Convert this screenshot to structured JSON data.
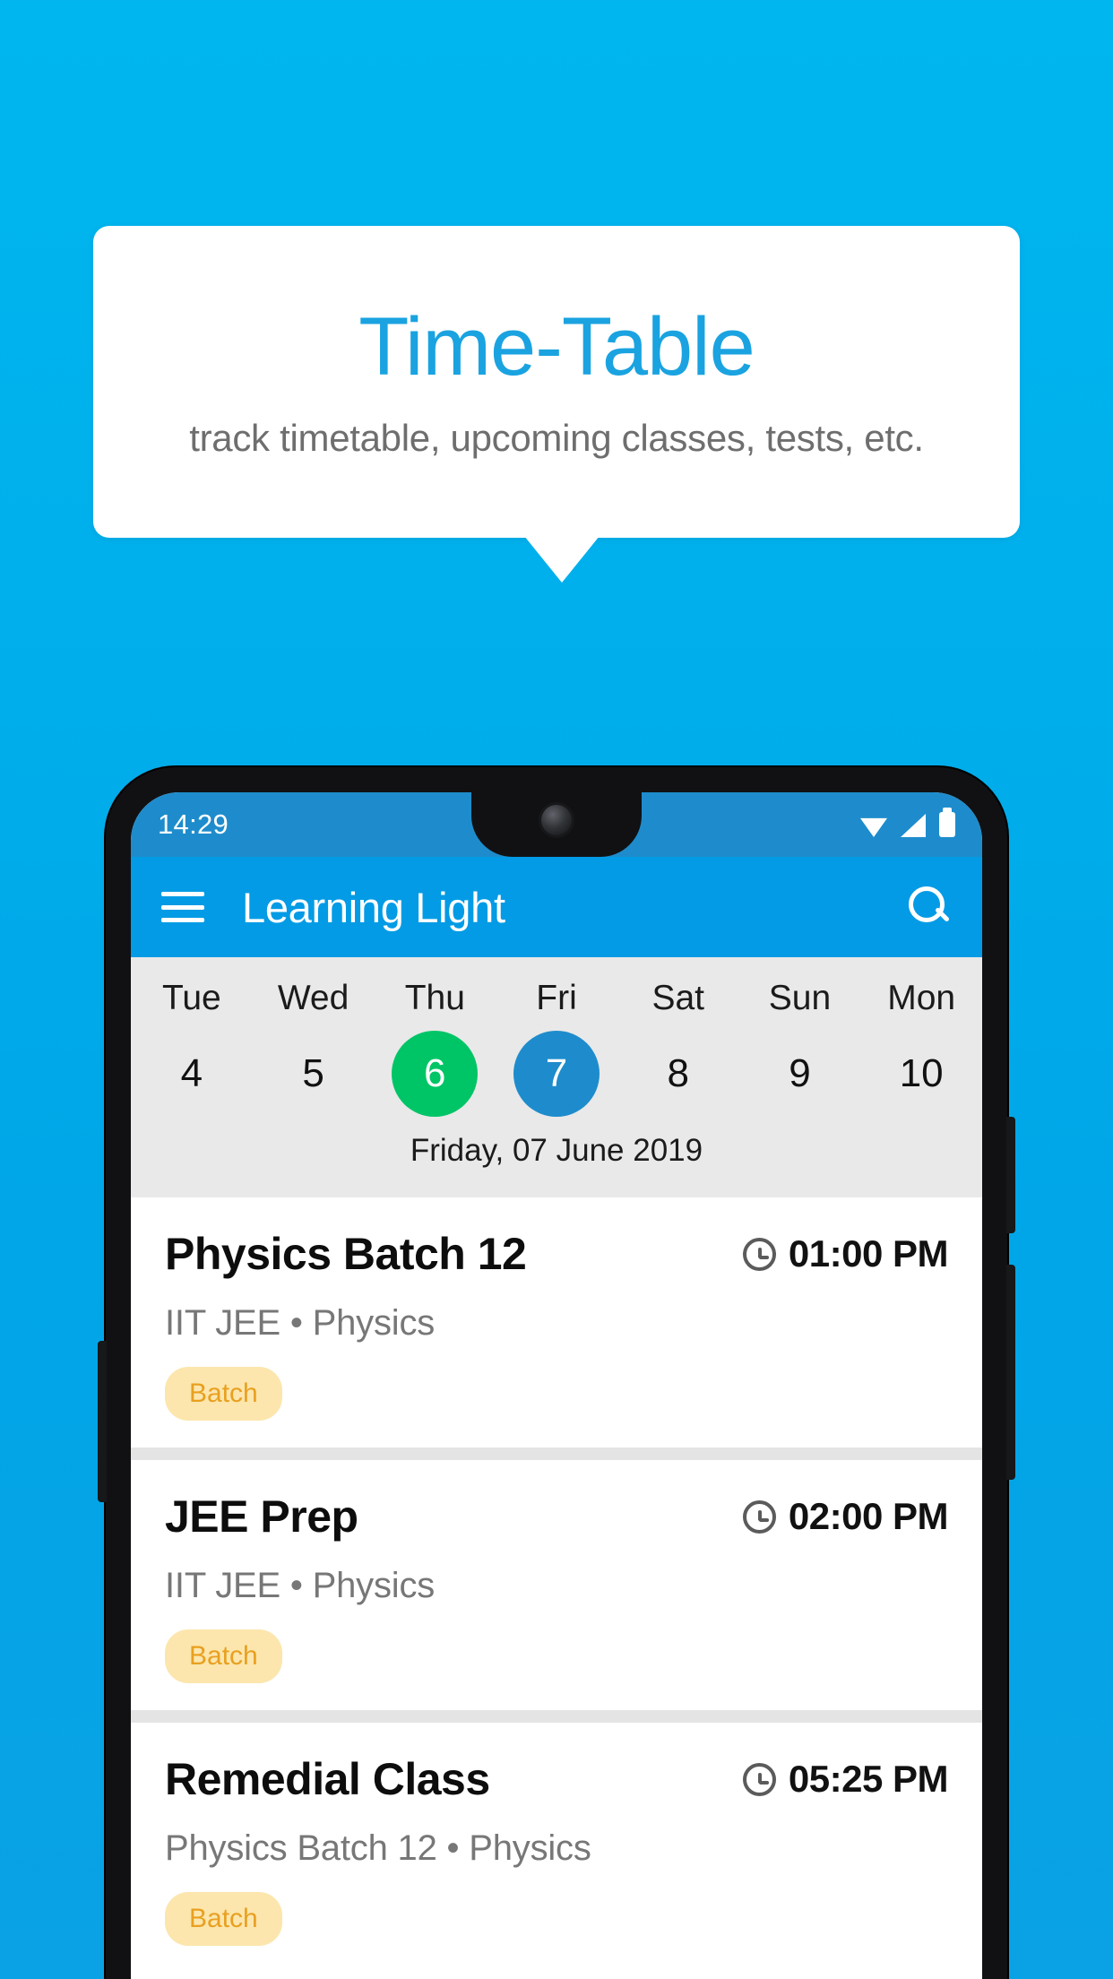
{
  "promo": {
    "title": "Time-Table",
    "subtitle": "track timetable, upcoming classes, tests, etc.",
    "title_color": "#1aa3e0",
    "background_color": "#00ace9"
  },
  "phone": {
    "statusbar": {
      "time": "14:29",
      "icons": [
        "wifi-icon",
        "signal-icon",
        "battery-icon"
      ],
      "background_color": "#1e8ccc"
    },
    "appbar": {
      "menu_icon": "hamburger-menu-icon",
      "title": "Learning Light",
      "search_icon": "search-icon",
      "background_color": "#039be5"
    },
    "calendar": {
      "days": [
        "Tue",
        "Wed",
        "Thu",
        "Fri",
        "Sat",
        "Sun",
        "Mon"
      ],
      "dates": [
        {
          "num": "4",
          "state": "normal"
        },
        {
          "num": "5",
          "state": "normal"
        },
        {
          "num": "6",
          "state": "today"
        },
        {
          "num": "7",
          "state": "selected"
        },
        {
          "num": "8",
          "state": "normal"
        },
        {
          "num": "9",
          "state": "normal"
        },
        {
          "num": "10",
          "state": "normal"
        }
      ],
      "today_color": "#00c566",
      "selected_color": "#1e8ccc",
      "full_date": "Friday, 07 June 2019"
    },
    "classes": [
      {
        "title": "Physics Batch 12",
        "time": "01:00 PM",
        "subtitle": "IIT JEE • Physics",
        "badge": "Batch"
      },
      {
        "title": "JEE Prep",
        "time": "02:00 PM",
        "subtitle": "IIT JEE • Physics",
        "badge": "Batch"
      },
      {
        "title": "Remedial Class",
        "time": "05:25 PM",
        "subtitle": "Physics Batch 12 • Physics",
        "badge": "Batch"
      }
    ]
  }
}
